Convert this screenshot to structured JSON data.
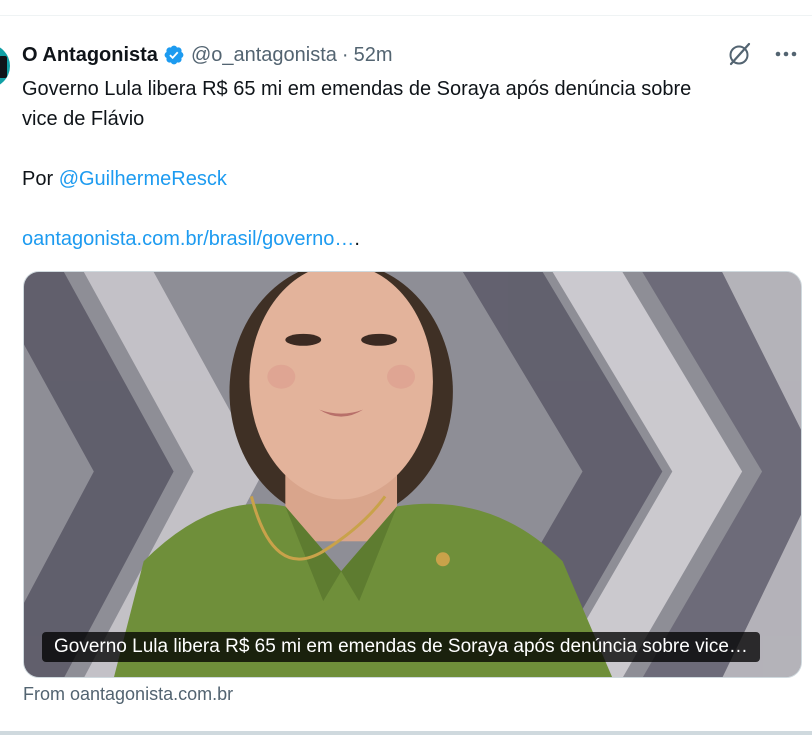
{
  "tweet": {
    "author_name": "O Antagonista",
    "handle": "@o_antagonista",
    "separator": "·",
    "time": "52m",
    "text_line1": "Governo Lula libera R$ 65 mi em emendas de Soraya após denúncia sobre",
    "text_line2": "vice de Flávio",
    "by_label": "Por",
    "mention": "@GuilhermeResck",
    "link_text": "oantagonista.com.br/brasil/governo…",
    "link_tail": "."
  },
  "card": {
    "caption": "Governo Lula libera R$ 65 mi em emendas de Soraya após denúncia sobre vice…",
    "source": "From oantagonista.com.br"
  },
  "icons": {
    "verified": "verified-badge-icon",
    "grok": "grok-icon",
    "more": "more-icon"
  },
  "colors": {
    "accent": "#1d9bf0",
    "text": "#0f1419",
    "muted": "#536471",
    "avatar_bg": "#12a0a6",
    "photo_shirt": "#6f8f3a"
  }
}
